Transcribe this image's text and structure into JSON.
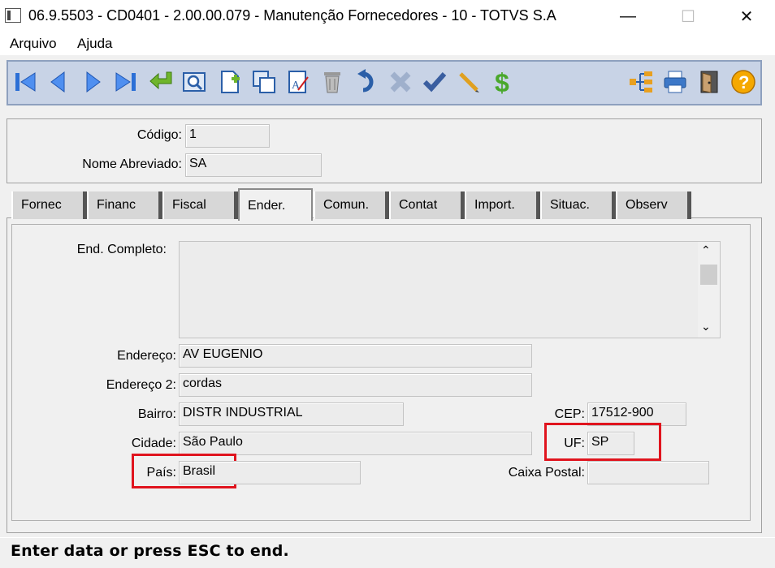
{
  "window": {
    "title": "06.9.5503 - CD0401 - 2.00.00.079 - Manutenção Fornecedores - 10 - TOTVS S.A",
    "minimize": "—",
    "maximize": "☐",
    "close": "✕"
  },
  "menu": {
    "items": [
      "Arquivo",
      "Ajuda"
    ]
  },
  "toolbar": {
    "buttons": [
      "first-icon",
      "previous-icon",
      "next-icon",
      "last-icon",
      "goto-icon",
      "search-icon",
      "add-icon",
      "copy-icon",
      "edit-icon",
      "delete-icon",
      "undo-icon",
      "cancel-icon",
      "save-icon",
      "pencil-icon",
      "dollar-icon",
      "tree-icon",
      "print-icon",
      "exit-icon",
      "help-icon"
    ]
  },
  "header": {
    "codigo_label": "Código:",
    "codigo_value": "1",
    "nome_label": "Nome Abreviado:",
    "nome_value": "SA"
  },
  "tabs": [
    "Fornec",
    "Financ",
    "Fiscal",
    "Ender.",
    "Comun.",
    "Contat",
    "Import.",
    "Situac.",
    "Observ"
  ],
  "active_tab": "Ender.",
  "form": {
    "end_completo_label": "End. Completo:",
    "end_completo_value": "",
    "endereco_label": "Endereço:",
    "endereco_value": "AV EUGENIO",
    "endereco2_label": "Endereço 2:",
    "endereco2_value": "cordas",
    "bairro_label": "Bairro:",
    "bairro_value": "DISTR INDUSTRIAL",
    "cep_label": "CEP:",
    "cep_value": "17512-900",
    "cidade_label": "Cidade:",
    "cidade_value": "São Paulo",
    "uf_label": "UF:",
    "uf_value": "SP",
    "pais_label": "País:",
    "pais_value": "Brasil",
    "caixa_postal_label": "Caixa Postal:",
    "caixa_postal_value": ""
  },
  "highlight_color": "#e0141e",
  "status": {
    "text": "Enter data or press ESC to end."
  }
}
